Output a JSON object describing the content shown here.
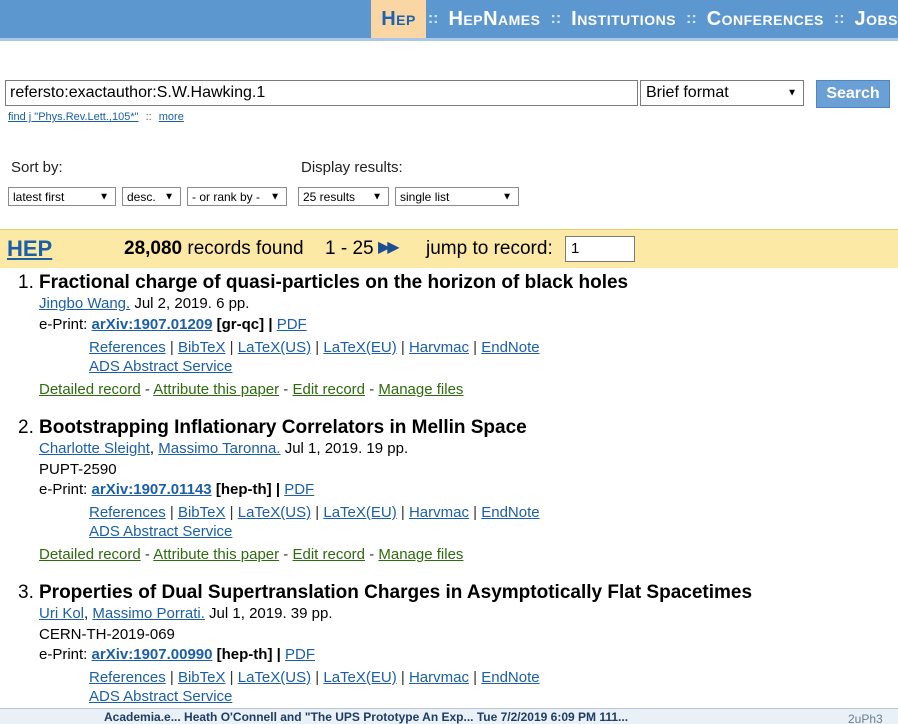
{
  "nav": {
    "items": [
      "Hep",
      "HepNames",
      "Institutions",
      "Conferences",
      "Jobs"
    ],
    "separator": "::"
  },
  "search": {
    "query": "refersto:exactauthor:S.W.Hawking.1",
    "format": "Brief format",
    "button": "Search",
    "hint_example": "find j \"Phys.Rev.Lett.,105*\"",
    "hint_sep": "::",
    "hint_more": "more"
  },
  "sort": {
    "label": "Sort by:",
    "order": "latest first",
    "direction": "desc.",
    "rank": "- or rank by -"
  },
  "display": {
    "label": "Display results:",
    "count": "25 results",
    "mode": "single list"
  },
  "results": {
    "collection": "HEP",
    "count": "28,080",
    "count_suffix": "records found",
    "range": "1 - 25",
    "next_icons": "▶▶",
    "jump_label": "jump to record:",
    "jump_value": "1"
  },
  "records": [
    {
      "num": "1.",
      "title": "Fractional charge of quasi-particles on the horizon of black holes",
      "authors": [
        "Jingbo Wang."
      ],
      "meta": " Jul 2, 2019. 6 pp.",
      "report": "",
      "eprint_label": "e-Print:",
      "arxiv": "arXiv:1907.01209",
      "category": "[gr-qc]",
      "pdf": "PDF"
    },
    {
      "num": "2.",
      "title": "Bootstrapping Inflationary Correlators in Mellin Space",
      "authors": [
        "Charlotte Sleight",
        "Massimo Taronna."
      ],
      "meta": " Jul 1, 2019. 19 pp.",
      "report": "PUPT-2590",
      "eprint_label": "e-Print:",
      "arxiv": "arXiv:1907.01143",
      "category": "[hep-th]",
      "pdf": "PDF"
    },
    {
      "num": "3.",
      "title": "Properties of Dual Supertranslation Charges in Asymptotically Flat Spacetimes",
      "authors": [
        "Uri Kol",
        "Massimo Porrati."
      ],
      "meta": " Jul 1, 2019. 39 pp.",
      "report": "CERN-TH-2019-069",
      "eprint_label": "e-Print:",
      "arxiv": "arXiv:1907.00990",
      "category": "[hep-th]",
      "pdf": "PDF"
    }
  ],
  "export_links": [
    "References",
    "BibTeX",
    "LaTeX(US)",
    "LaTeX(EU)",
    "Harvmac",
    "EndNote"
  ],
  "ads_link": "ADS Abstract Service",
  "action_links": [
    "Detailed record",
    "Attribute this paper",
    "Edit record",
    "Manage files"
  ],
  "taskbar": {
    "row": "Academia.e...  Heath O'Connell and \"The UPS Prototype An Exp...  Tue 7/2/2019 6:09 PM     111...",
    "right": "2uPh3"
  }
}
